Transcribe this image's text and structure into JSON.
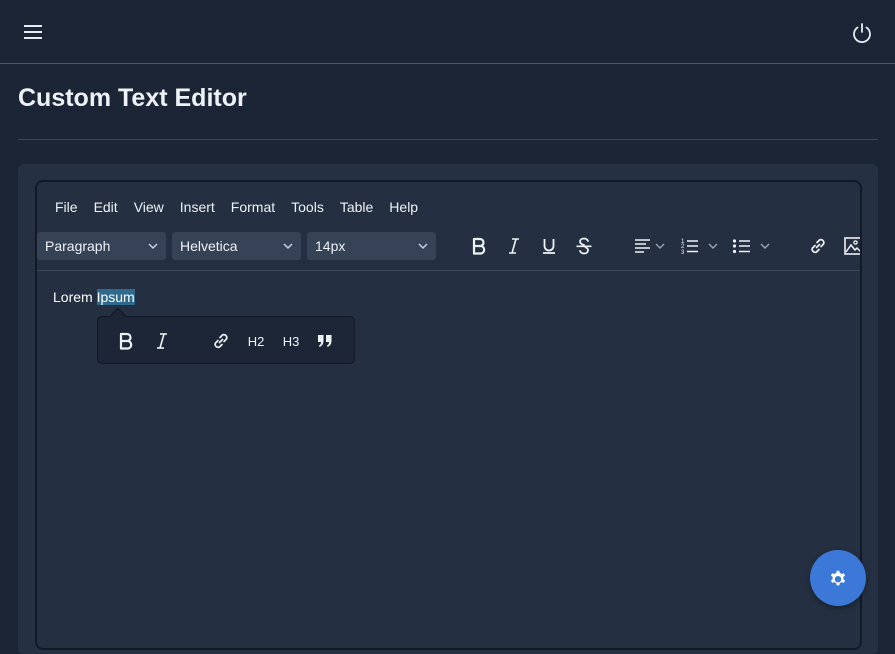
{
  "header": {
    "menu_icon": "hamburger-menu-icon",
    "power_icon": "power-icon"
  },
  "page": {
    "title": "Custom Text Editor"
  },
  "editor": {
    "menubar": [
      "File",
      "Edit",
      "View",
      "Insert",
      "Format",
      "Tools",
      "Table",
      "Help"
    ],
    "block_format": "Paragraph",
    "font_family": "Helvetica",
    "font_size": "14px",
    "toolbar_icons": [
      "bold-icon",
      "italic-icon",
      "underline-icon",
      "strikethrough-icon",
      "align-left-icon",
      "numbered-list-icon",
      "bullet-list-icon",
      "link-icon",
      "image-icon"
    ],
    "content": {
      "text_before": "Lorem ",
      "selected_text": "Ipsum"
    },
    "bubble_toolbar": {
      "h2_label": "H2",
      "h3_label": "H3",
      "icons": [
        "bold-icon",
        "italic-icon",
        "link-icon",
        "quote-icon"
      ]
    }
  },
  "fab": {
    "icon": "gear-icon",
    "color": "#3c78d8"
  },
  "colors": {
    "background": "#1b2536",
    "card": "#253043",
    "selection": "#2f6a8e"
  }
}
